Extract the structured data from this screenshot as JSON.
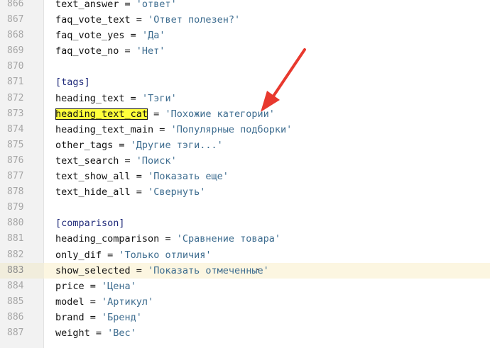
{
  "editor": {
    "current_line": "883",
    "lines": [
      {
        "num": "866",
        "key": "text_answer",
        "value": "'ответ'"
      },
      {
        "num": "867",
        "key": "faq_vote_text",
        "value": "'Ответ полезен?'"
      },
      {
        "num": "868",
        "key": "faq_vote_yes",
        "value": "'Да'"
      },
      {
        "num": "869",
        "key": "faq_vote_no",
        "value": "'Нет'"
      },
      {
        "num": "870"
      },
      {
        "num": "871",
        "section": "[tags]"
      },
      {
        "num": "872",
        "key": "heading_text",
        "value": "'Тэги'"
      },
      {
        "num": "873",
        "key": "heading_text_cat",
        "value": "'Похожие категории'",
        "highlighted": true
      },
      {
        "num": "874",
        "key": "heading_text_main",
        "value": "'Популярные подборки'"
      },
      {
        "num": "875",
        "key": "other_tags",
        "value": "'Другие тэги...'"
      },
      {
        "num": "876",
        "key": "text_search",
        "value": "'Поиск'"
      },
      {
        "num": "877",
        "key": "text_show_all",
        "value": "'Показать еще'"
      },
      {
        "num": "878",
        "key": "text_hide_all",
        "value": "'Свернуть'"
      },
      {
        "num": "879"
      },
      {
        "num": "880",
        "section": "[comparison]"
      },
      {
        "num": "881",
        "key": "heading_comparison",
        "value": "'Сравнение товара'"
      },
      {
        "num": "882",
        "key": "only_dif",
        "value": "'Только отличия'"
      },
      {
        "num": "883",
        "key": "show_selected",
        "value": "'Показать отмеченные'",
        "current": true
      },
      {
        "num": "884",
        "key": "price",
        "value": "'Цена'"
      },
      {
        "num": "885",
        "key": "model",
        "value": "'Артикул'"
      },
      {
        "num": "886",
        "key": "brand",
        "value": "'Бренд'"
      },
      {
        "num": "887",
        "key": "weight",
        "value": "'Вес'"
      }
    ]
  },
  "annotation": {
    "arrow_color": "#e8392e",
    "highlight_color": "#ffff3a"
  },
  "colors": {
    "string": "#3d6c8f",
    "section": "#1f2a7a",
    "gutter_bg": "#f2f2f2",
    "current_line_bg": "#fcf6e1"
  }
}
